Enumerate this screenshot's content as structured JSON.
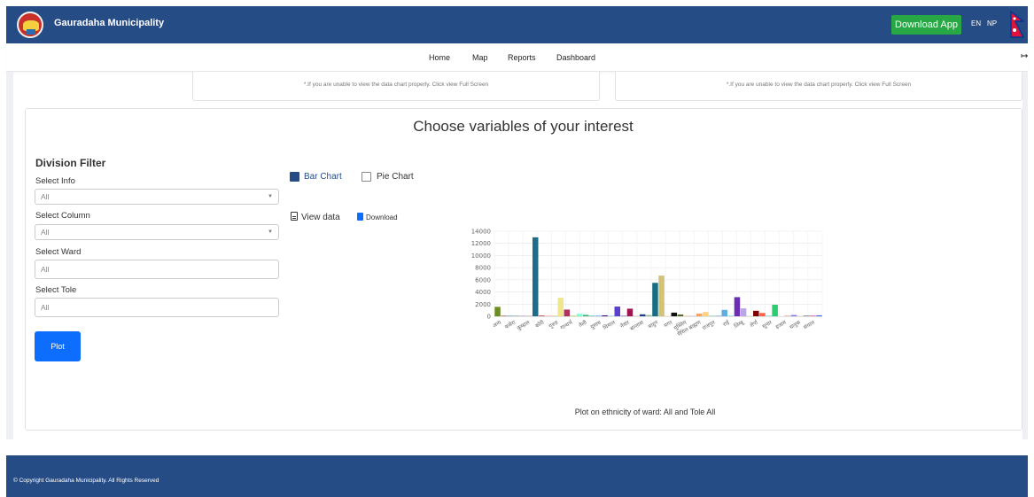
{
  "header": {
    "brand": "Gauradaha Municipality",
    "download_app": "Download App",
    "lang_en": "EN",
    "lang_np": "NP",
    "brand_color": "#264c86"
  },
  "nav": {
    "items": [
      "Home",
      "Map",
      "Reports",
      "Dashboard"
    ]
  },
  "top_cards": {
    "note": "*.If you are unable to view the data chart properly. Click view Full Screen"
  },
  "main": {
    "heading": "Choose variables of your interest",
    "filter_title": "Division Filter",
    "select_info_label": "Select Info",
    "select_info_value": "All",
    "select_column_label": "Select Column",
    "select_column_value": "All",
    "select_ward_label": "Select Ward",
    "select_ward_value": "All",
    "select_tole_label": "Select Tole",
    "select_tole_value": "All",
    "plot_button": "Plot",
    "bar_chart_label": "Bar Chart",
    "pie_chart_label": "Pie Chart",
    "view_data": "View data",
    "download": "Download",
    "caption": "Plot on ethnicity of ward: All and Tole All"
  },
  "chart_data": {
    "type": "bar",
    "ylim": [
      0,
      14000
    ],
    "yticks": [
      0,
      2000,
      4000,
      6000,
      8000,
      10000,
      12000,
      14000
    ],
    "tick_labels": [
      "अन्य",
      "कसेरा",
      "कुम्हाल",
      "कोरी",
      "गुरुङ",
      "गान्धर्भ",
      "तेली",
      "दुसाध",
      "धिमाल",
      "नेवार",
      "बान्तावा",
      "बाहुन",
      "मगर",
      "मुस्लिम",
      "मैथिल ब्राह्मण",
      "राजपूत",
      "राई",
      "लिम्बू",
      "शेर्पा",
      "सुनार",
      "हजाम",
      "धानुक",
      "संथाल"
    ],
    "values": [
      1550,
      60,
      80,
      60,
      40,
      20,
      13000,
      100,
      80,
      60,
      3050,
      1100,
      80,
      420,
      230,
      80,
      80,
      150,
      80,
      1600,
      80,
      1250,
      80,
      320,
      200,
      5500,
      6700,
      80,
      600,
      300,
      150,
      80,
      450,
      700,
      80,
      150,
      1050,
      80,
      3150,
      1300,
      80,
      900,
      550,
      80,
      1900,
      80,
      80,
      200,
      80,
      80,
      80,
      150
    ],
    "colors": [
      "#6b8e23",
      "#8b0000",
      "#4682b4",
      "#2e8b57",
      "#9932cc",
      "#a0522d",
      "#1e6b8a",
      "#b22222",
      "#ff9999",
      "#daa520",
      "#f0e68c",
      "#b03060",
      "#9acd32",
      "#7fffd4",
      "#3cb371",
      "#20b2aa",
      "#1e90ff",
      "#4b0082",
      "#87ceeb",
      "#5b3fd1",
      "#6a5acd",
      "#a0154f",
      "#ffb6c1",
      "#1f3c88",
      "#8fbc8f",
      "#176d81",
      "#d2c27a",
      "#ffdab9",
      "#111111",
      "#556b2f",
      "#f5deb3",
      "#d8bfd8",
      "#f4a460",
      "#ffd27f",
      "#66cdaa",
      "#b0c4de",
      "#5dade2",
      "#40e0d0",
      "#6a2fb4",
      "#b8a6e6",
      "#e0e0e0",
      "#800000",
      "#ff6347",
      "#48d1cc",
      "#2ecc71",
      "#ffffff",
      "#f08080",
      "#8470ff",
      "#dcdcdc",
      "#2f4f4f",
      "#c71585",
      "#4169e1"
    ]
  }
}
